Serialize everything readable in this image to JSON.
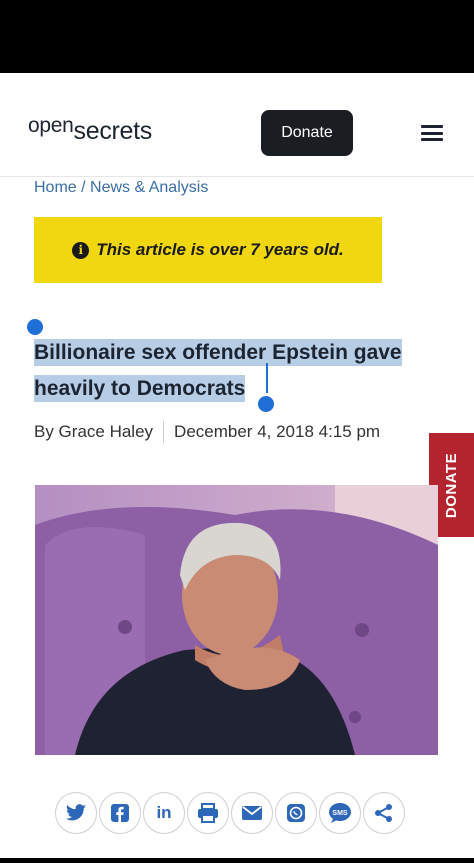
{
  "header": {
    "logo_open": "open",
    "logo_secrets": "secrets",
    "donate_label": "Donate"
  },
  "breadcrumb": {
    "home": "Home",
    "separator": "/",
    "section": "News & Analysis"
  },
  "notice": {
    "text": "This article is over 7 years old."
  },
  "article": {
    "title": "Billionaire sex offender Epstein gave heavily to Democrats",
    "author": "By Grace Haley",
    "date": "December 4, 2018 4:15 pm"
  },
  "side_tab": {
    "label": "DONATE"
  },
  "share": {
    "items": [
      "twitter-icon",
      "facebook-icon",
      "linkedin-icon",
      "print-icon",
      "email-icon",
      "whatsapp-icon",
      "sms-icon",
      "share-icon"
    ],
    "linkedin_text": "in",
    "sms_text": "SMS"
  },
  "colors": {
    "notice_bg": "#f0d70f",
    "side_donate_bg": "#b3242e",
    "link": "#3a6ea5",
    "selection": "#b7cde6",
    "share_icon": "#2c67b8"
  }
}
